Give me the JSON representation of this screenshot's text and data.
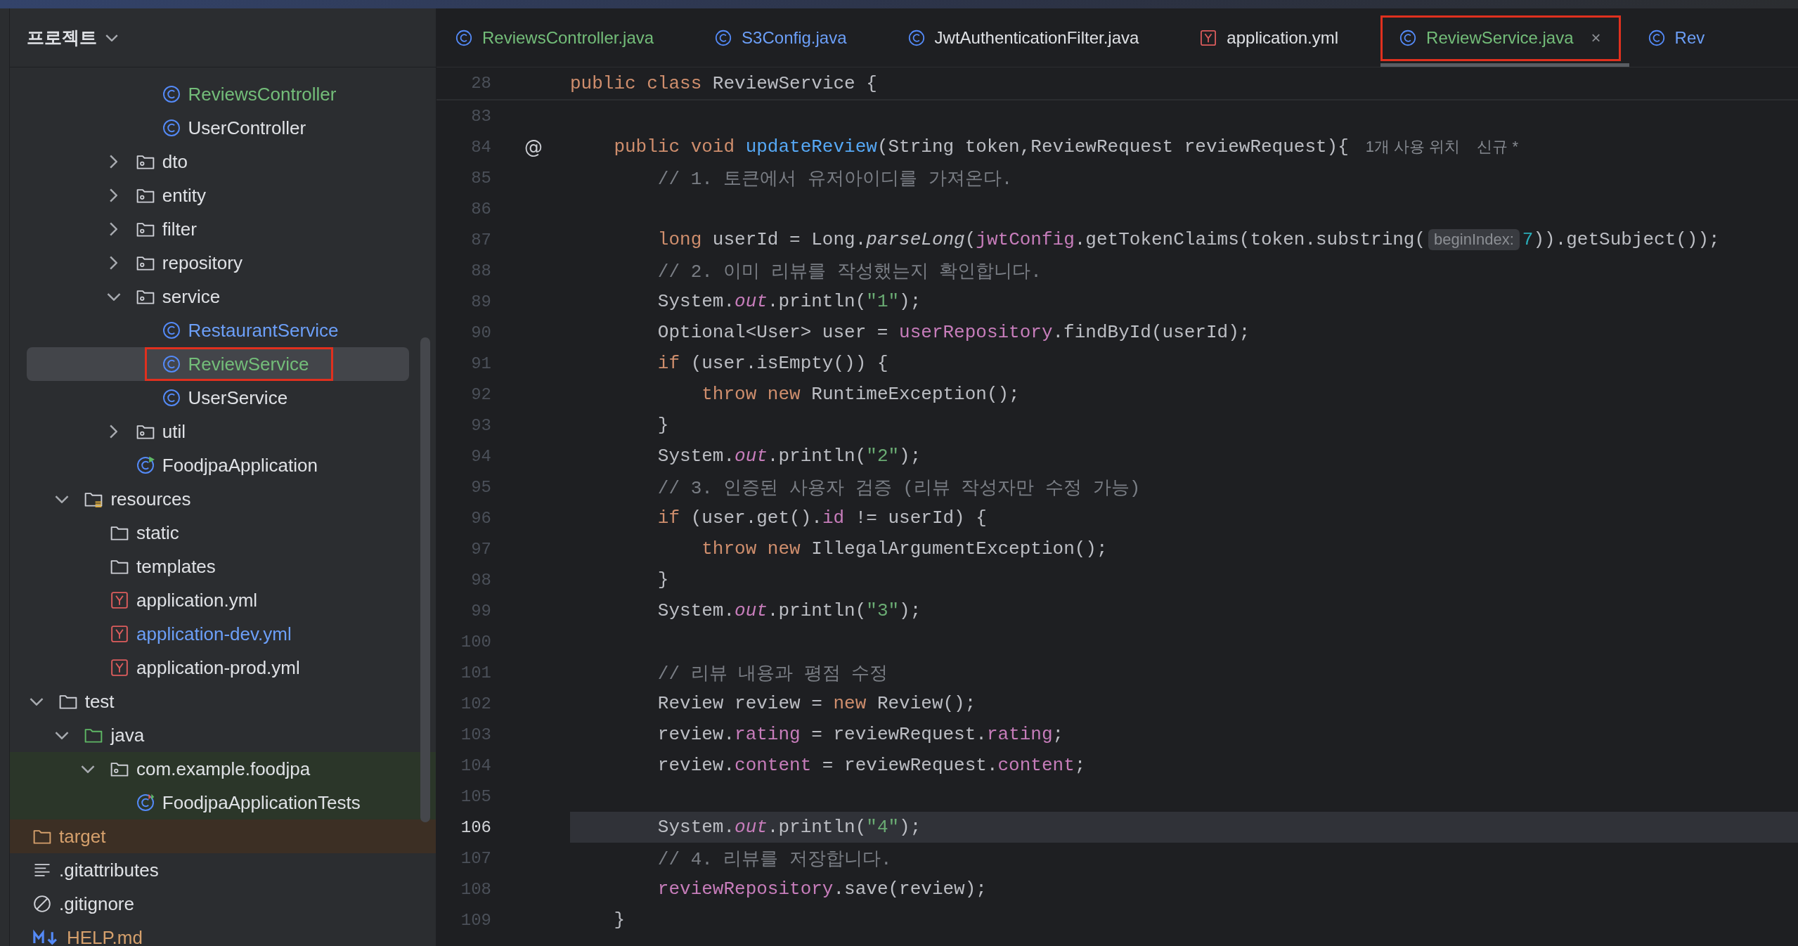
{
  "sidebar": {
    "title": "프로젝트",
    "tree": [
      {
        "children": [
          {
            "children": [
              {
                "children": [
                  {
                    "children": [
                      {
                        "children": [
                          {
                            "label": "ReviewsController",
                            "kind": "class",
                            "color": "#73bd79",
                            "selected": false,
                            "annotated": false
                          },
                          {
                            "label": "UserController",
                            "kind": "class",
                            "color": "#dfe1e5",
                            "selected": false,
                            "annotated": false
                          }
                        ]
                      },
                      {
                        "label": "dto",
                        "kind": "package",
                        "color": "#dfe1e5",
                        "expanded": false,
                        "selected": false,
                        "annotated": false
                      },
                      {
                        "label": "entity",
                        "kind": "package",
                        "color": "#dfe1e5",
                        "expanded": false,
                        "selected": false,
                        "annotated": false
                      },
                      {
                        "label": "filter",
                        "kind": "package",
                        "color": "#dfe1e5",
                        "expanded": false,
                        "selected": false,
                        "annotated": false
                      },
                      {
                        "label": "repository",
                        "kind": "package",
                        "color": "#dfe1e5",
                        "expanded": false,
                        "selected": false,
                        "annotated": false
                      },
                      {
                        "label": "service",
                        "kind": "package",
                        "color": "#dfe1e5",
                        "expanded": true,
                        "selected": false,
                        "annotated": false,
                        "children": [
                          {
                            "label": "RestaurantService",
                            "kind": "class",
                            "color": "#6c9ff8",
                            "selected": false,
                            "annotated": false
                          },
                          {
                            "label": "ReviewService",
                            "kind": "class",
                            "color": "#73bd79",
                            "selected": true,
                            "annotated": true
                          },
                          {
                            "label": "UserService",
                            "kind": "class",
                            "color": "#dfe1e5",
                            "selected": false,
                            "annotated": false
                          }
                        ]
                      },
                      {
                        "label": "util",
                        "kind": "package",
                        "color": "#dfe1e5",
                        "expanded": false,
                        "selected": false,
                        "annotated": false
                      },
                      {
                        "label": "FoodjpaApplication",
                        "kind": "app-class",
                        "color": "#dfe1e5",
                        "selected": false,
                        "annotated": false
                      }
                    ]
                  }
                ]
              },
              {
                "label": "resources",
                "kind": "resources",
                "color": "#dfe1e5",
                "expanded": true,
                "selected": false,
                "annotated": false,
                "children": [
                  {
                    "label": "static",
                    "kind": "folder",
                    "color": "#dfe1e5",
                    "selected": false,
                    "annotated": false
                  },
                  {
                    "label": "templates",
                    "kind": "folder",
                    "color": "#dfe1e5",
                    "selected": false,
                    "annotated": false
                  },
                  {
                    "label": "application.yml",
                    "kind": "yml",
                    "color": "#dfe1e5",
                    "selected": false,
                    "annotated": false
                  },
                  {
                    "label": "application-dev.yml",
                    "kind": "yml",
                    "color": "#6c9ff8",
                    "selected": false,
                    "annotated": false
                  },
                  {
                    "label": "application-prod.yml",
                    "kind": "yml",
                    "color": "#dfe1e5",
                    "selected": false,
                    "annotated": false
                  }
                ]
              }
            ]
          },
          {
            "label": "test",
            "kind": "folder",
            "color": "#dfe1e5",
            "expanded": true,
            "selected": false,
            "annotated": false,
            "children": [
              {
                "label": "java",
                "kind": "test-root",
                "color": "#dfe1e5",
                "expanded": true,
                "selected": false,
                "annotated": false,
                "children": [
                  {
                    "label": "com.example.foodjpa",
                    "kind": "package",
                    "color": "#dfe1e5",
                    "expanded": true,
                    "selected": false,
                    "annotated": false,
                    "children": [
                      {
                        "label": "FoodjpaApplicationTests",
                        "kind": "test-class",
                        "color": "#dfe1e5",
                        "selected": false,
                        "annotated": false
                      }
                    ]
                  }
                ]
              }
            ]
          }
        ]
      },
      {
        "label": "target",
        "kind": "excluded-folder",
        "color": "#d5a06c",
        "selected": false,
        "annotated": false
      },
      {
        "label": ".gitattributes",
        "kind": "text",
        "color": "#dfe1e5",
        "selected": false,
        "annotated": false
      },
      {
        "label": ".gitignore",
        "kind": "ignore",
        "color": "#dfe1e5",
        "selected": false,
        "annotated": false
      },
      {
        "label": "HELP.md",
        "kind": "markdown",
        "color": "#d5a06c",
        "selected": false,
        "annotated": false
      }
    ]
  },
  "tabs": [
    {
      "label": "ReviewsController.java",
      "kind": "class",
      "color": "#73bd79",
      "selected": false,
      "annotated": false
    },
    {
      "label": "S3Config.java",
      "kind": "class",
      "color": "#6c9ff8",
      "selected": false,
      "annotated": false
    },
    {
      "label": "JwtAuthenticationFilter.java",
      "kind": "class",
      "color": "#dfe1e5",
      "selected": false,
      "annotated": false
    },
    {
      "label": "application.yml",
      "kind": "yml",
      "color": "#dfe1e5",
      "selected": false,
      "annotated": false
    },
    {
      "label": "ReviewService.java",
      "kind": "class",
      "color": "#73bd79",
      "selected": true,
      "annotated": true,
      "close": "×"
    },
    {
      "label": "Rev",
      "kind": "class",
      "color": "#6c9ff8",
      "selected": false,
      "annotated": false
    }
  ],
  "editor": {
    "sticky_line": {
      "number": "28",
      "tokens": [
        {
          "kind": "keyword",
          "text": "public"
        },
        {
          "kind": "keyword",
          "text": " class"
        },
        {
          "kind": "plain",
          "text": " ReviewService {"
        }
      ]
    },
    "lines": [
      {
        "number": "83",
        "current": false
      },
      {
        "number": "84",
        "current": false,
        "gutter": "@",
        "tokens": [
          {
            "kind": "keyword",
            "text": "    public"
          },
          {
            "kind": "keyword",
            "text": " void"
          },
          {
            "kind": "function",
            "text": " updateReview"
          },
          {
            "kind": "plain",
            "text": "(String token,ReviewRequest reviewRequest){"
          },
          {
            "kind": "usage",
            "text": "1개 사용 위치"
          },
          {
            "kind": "usage",
            "text": "신규 *"
          }
        ]
      },
      {
        "number": "85",
        "current": false,
        "tokens": [
          {
            "kind": "comment",
            "text": "        // 1. 토큰에서 유저아이디를 가져온다."
          }
        ]
      },
      {
        "number": "86",
        "current": false
      },
      {
        "number": "87",
        "current": false,
        "tokens": [
          {
            "kind": "keyword",
            "text": "        long"
          },
          {
            "kind": "plain",
            "text": " userId = Long."
          },
          {
            "kind": "static",
            "text": "parseLong"
          },
          {
            "kind": "plain",
            "text": "("
          },
          {
            "kind": "member",
            "text": "jwtConfig"
          },
          {
            "kind": "plain",
            "text": ".getTokenClaims(token.substring("
          },
          {
            "kind": "hint",
            "text": "beginIndex:"
          },
          {
            "kind": "number",
            "text": "7"
          },
          {
            "kind": "plain",
            "text": ")).getSubject());"
          }
        ]
      },
      {
        "number": "88",
        "current": false,
        "tokens": [
          {
            "kind": "comment",
            "text": "        // 2. 이미 리뷰를 작성했는지 확인합니다."
          }
        ]
      },
      {
        "number": "89",
        "current": false,
        "tokens": [
          {
            "kind": "plain",
            "text": "        System."
          },
          {
            "kind": "static-member",
            "text": "out"
          },
          {
            "kind": "plain",
            "text": ".println("
          },
          {
            "kind": "string",
            "text": "\"1\""
          },
          {
            "kind": "plain",
            "text": ");"
          }
        ]
      },
      {
        "number": "90",
        "current": false,
        "tokens": [
          {
            "kind": "plain",
            "text": "        Optional<User> user = "
          },
          {
            "kind": "member",
            "text": "userRepository"
          },
          {
            "kind": "plain",
            "text": ".findById(userId);"
          }
        ]
      },
      {
        "number": "91",
        "current": false,
        "tokens": [
          {
            "kind": "keyword",
            "text": "        if"
          },
          {
            "kind": "plain",
            "text": " (user.isEmpty()) {"
          }
        ]
      },
      {
        "number": "92",
        "current": false,
        "tokens": [
          {
            "kind": "keyword",
            "text": "            throw"
          },
          {
            "kind": "keyword",
            "text": " new"
          },
          {
            "kind": "plain",
            "text": " RuntimeException();"
          }
        ]
      },
      {
        "number": "93",
        "current": false,
        "tokens": [
          {
            "kind": "plain",
            "text": "        }"
          }
        ]
      },
      {
        "number": "94",
        "current": false,
        "tokens": [
          {
            "kind": "plain",
            "text": "        System."
          },
          {
            "kind": "static-member",
            "text": "out"
          },
          {
            "kind": "plain",
            "text": ".println("
          },
          {
            "kind": "string",
            "text": "\"2\""
          },
          {
            "kind": "plain",
            "text": ");"
          }
        ]
      },
      {
        "number": "95",
        "current": false,
        "tokens": [
          {
            "kind": "comment",
            "text": "        // 3. 인증된 사용자 검증 (리뷰 작성자만 수정 가능)"
          }
        ]
      },
      {
        "number": "96",
        "current": false,
        "tokens": [
          {
            "kind": "keyword",
            "text": "        if"
          },
          {
            "kind": "plain",
            "text": " (user.get()."
          },
          {
            "kind": "member",
            "text": "id"
          },
          {
            "kind": "plain",
            "text": " != userId) {"
          }
        ]
      },
      {
        "number": "97",
        "current": false,
        "tokens": [
          {
            "kind": "keyword",
            "text": "            throw"
          },
          {
            "kind": "keyword",
            "text": " new"
          },
          {
            "kind": "plain",
            "text": " IllegalArgumentException();"
          }
        ]
      },
      {
        "number": "98",
        "current": false,
        "tokens": [
          {
            "kind": "plain",
            "text": "        }"
          }
        ]
      },
      {
        "number": "99",
        "current": false,
        "tokens": [
          {
            "kind": "plain",
            "text": "        System."
          },
          {
            "kind": "static-member",
            "text": "out"
          },
          {
            "kind": "plain",
            "text": ".println("
          },
          {
            "kind": "string",
            "text": "\"3\""
          },
          {
            "kind": "plain",
            "text": ");"
          }
        ]
      },
      {
        "number": "100",
        "current": false
      },
      {
        "number": "101",
        "current": false,
        "tokens": [
          {
            "kind": "comment",
            "text": "        // 리뷰 내용과 평점 수정"
          }
        ]
      },
      {
        "number": "102",
        "current": false,
        "tokens": [
          {
            "kind": "plain",
            "text": "        Review review = "
          },
          {
            "kind": "keyword",
            "text": "new"
          },
          {
            "kind": "plain",
            "text": " Review();"
          }
        ]
      },
      {
        "number": "103",
        "current": false,
        "tokens": [
          {
            "kind": "plain",
            "text": "        review."
          },
          {
            "kind": "member",
            "text": "rating"
          },
          {
            "kind": "plain",
            "text": " = reviewRequest."
          },
          {
            "kind": "member",
            "text": "rating"
          },
          {
            "kind": "plain",
            "text": ";"
          }
        ]
      },
      {
        "number": "104",
        "current": false,
        "tokens": [
          {
            "kind": "plain",
            "text": "        review."
          },
          {
            "kind": "member",
            "text": "content"
          },
          {
            "kind": "plain",
            "text": " = reviewRequest."
          },
          {
            "kind": "member",
            "text": "content"
          },
          {
            "kind": "plain",
            "text": ";"
          }
        ]
      },
      {
        "number": "105",
        "current": false
      },
      {
        "number": "106",
        "current": true,
        "tokens": [
          {
            "kind": "plain",
            "text": "        System."
          },
          {
            "kind": "static-member",
            "text": "out"
          },
          {
            "kind": "plain",
            "text": ".println("
          },
          {
            "kind": "string",
            "text": "\"4\""
          },
          {
            "kind": "plain",
            "text": ");"
          }
        ]
      },
      {
        "number": "107",
        "current": false,
        "tokens": [
          {
            "kind": "comment",
            "text": "        // 4. 리뷰를 저장합니다."
          }
        ]
      },
      {
        "number": "108",
        "current": false,
        "tokens": [
          {
            "kind": "member",
            "text": "        reviewRepository"
          },
          {
            "kind": "plain",
            "text": ".save(review);"
          }
        ]
      },
      {
        "number": "109",
        "current": false,
        "tokens": [
          {
            "kind": "plain",
            "text": "    }"
          }
        ]
      }
    ]
  }
}
